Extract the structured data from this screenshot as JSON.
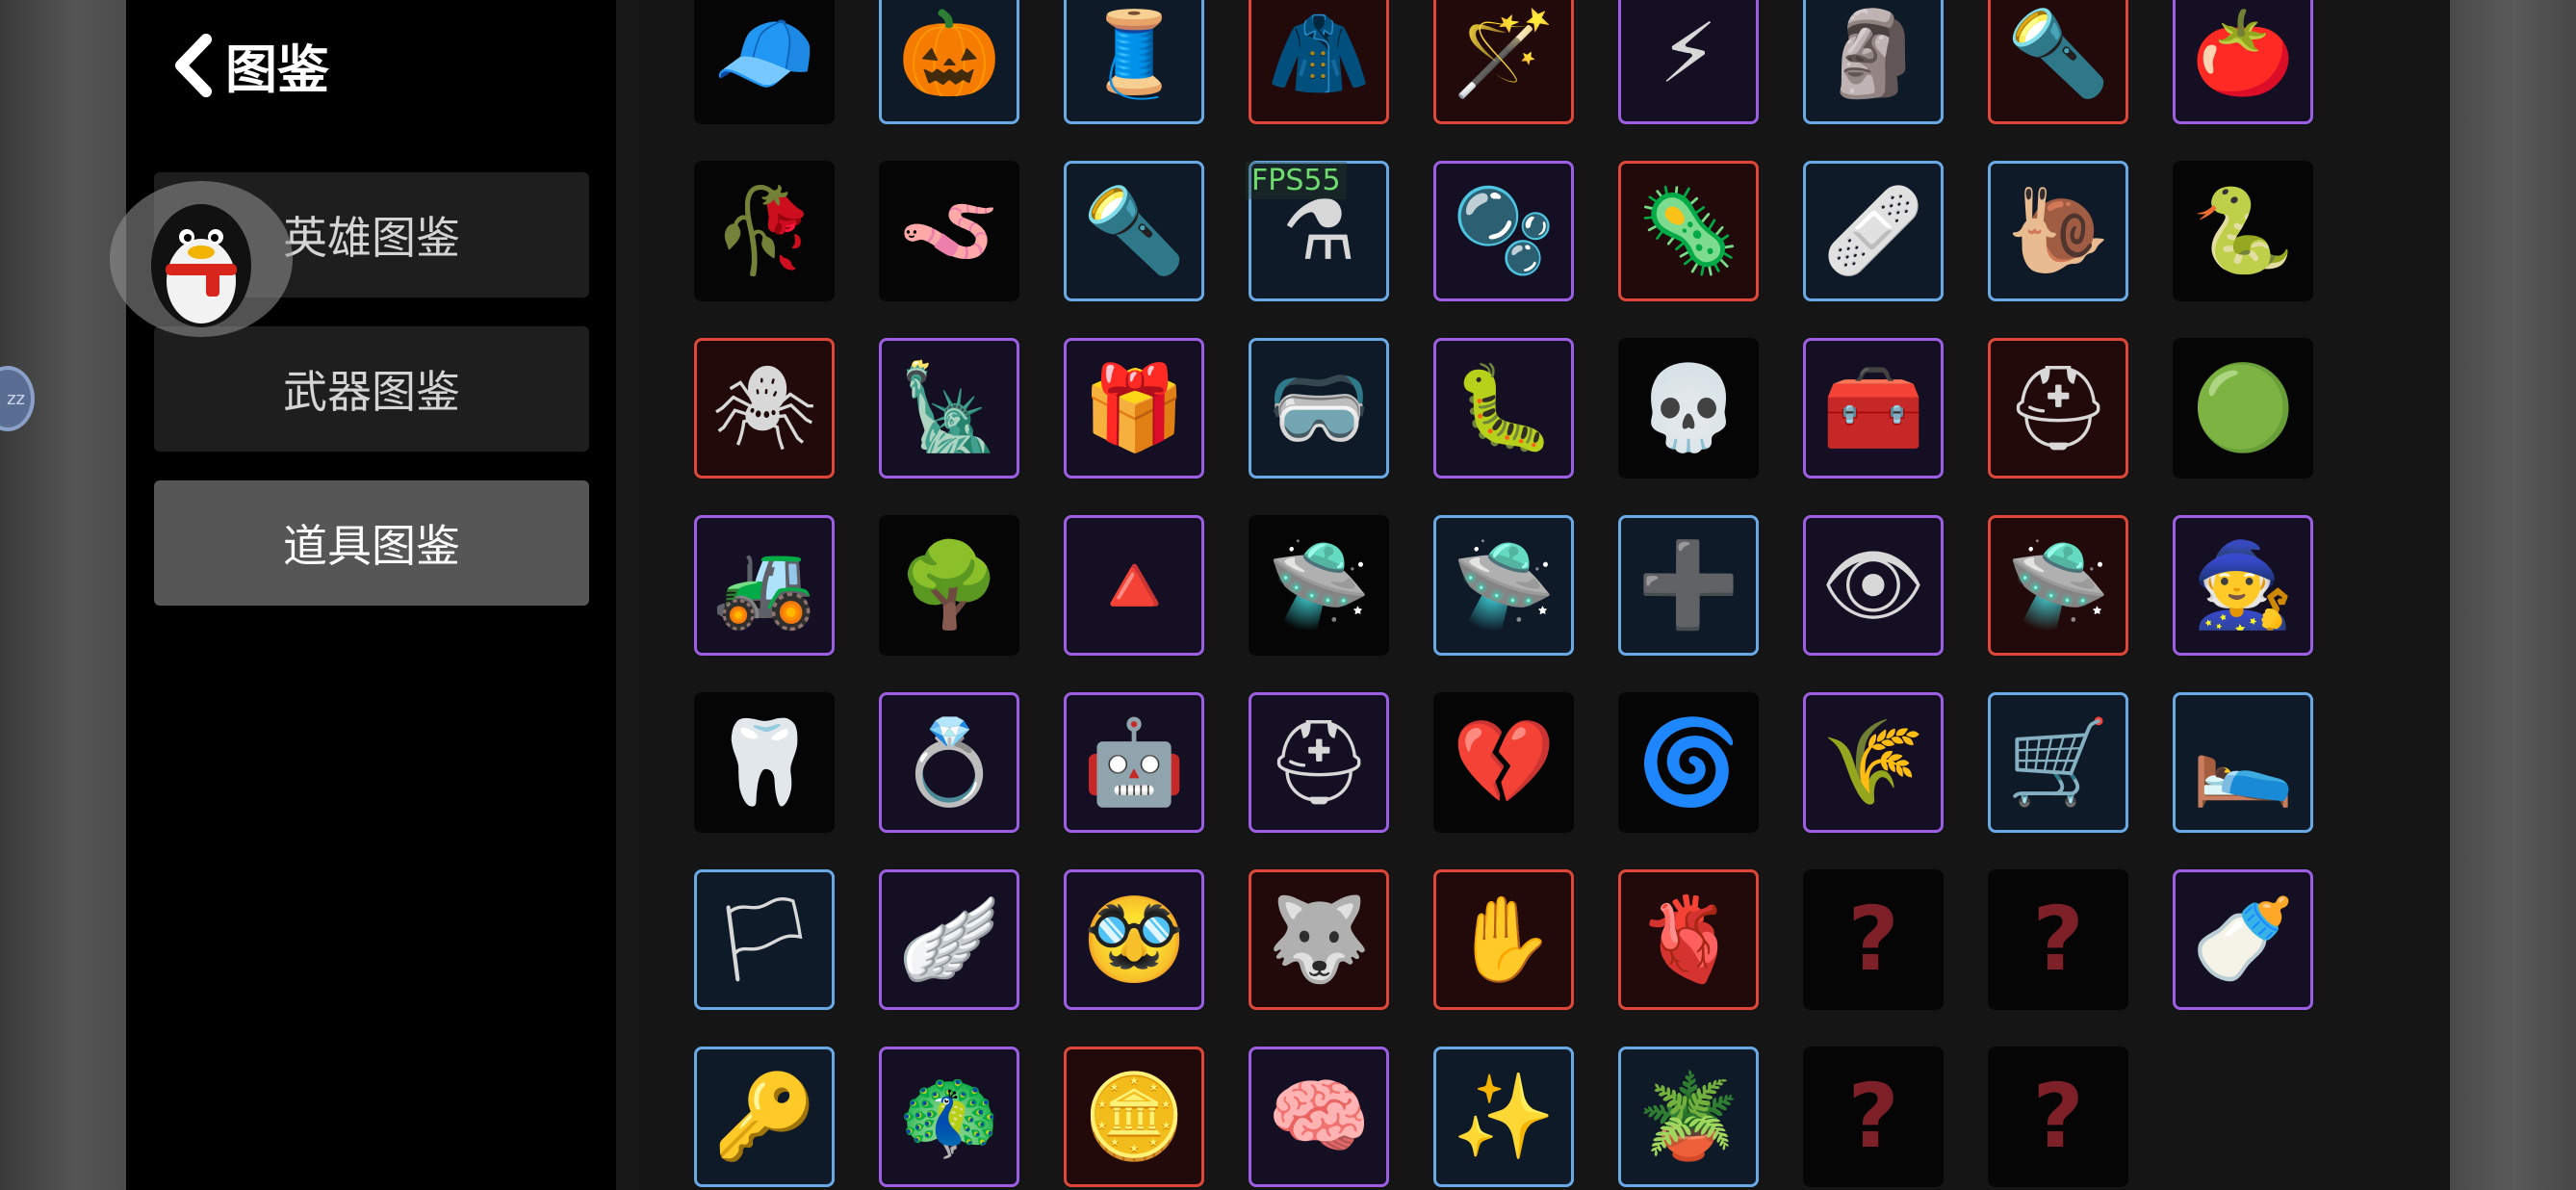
{
  "header": {
    "back_title": "图鉴"
  },
  "menu": [
    {
      "label": "英雄图鉴",
      "active": false
    },
    {
      "label": "武器图鉴",
      "active": false
    },
    {
      "label": "道具图鉴",
      "active": true
    }
  ],
  "overlay": {
    "fps": "FPS55",
    "float_dot_label": "zz"
  },
  "colors": {
    "blue": "#6aa8e6",
    "purple": "#9c5fe3",
    "red": "#e0473a"
  },
  "items": [
    {
      "icon": "propeller-cap-icon",
      "glyph": "🧢",
      "rarity": "none"
    },
    {
      "icon": "pumpkin-icon",
      "glyph": "🎃",
      "rarity": "blue"
    },
    {
      "icon": "sewing-machine-icon",
      "glyph": "🧵",
      "rarity": "blue"
    },
    {
      "icon": "red-hoodie-icon",
      "glyph": "🧥",
      "rarity": "red"
    },
    {
      "icon": "magic-wand-icon",
      "glyph": "🪄",
      "rarity": "red"
    },
    {
      "icon": "claw-marks-icon",
      "glyph": "⚡",
      "rarity": "purple"
    },
    {
      "icon": "stone-circle-icon",
      "glyph": "🗿",
      "rarity": "blue"
    },
    {
      "icon": "torch-icon",
      "glyph": "🔦",
      "rarity": "red"
    },
    {
      "icon": "sad-tomato-icon",
      "glyph": "🍅",
      "rarity": "purple"
    },
    {
      "icon": "thorn-branch-icon",
      "glyph": "🥀",
      "rarity": "none"
    },
    {
      "icon": "worm-icon",
      "glyph": "🪱",
      "rarity": "none"
    },
    {
      "icon": "flashlight-icon",
      "glyph": "🔦",
      "rarity": "blue"
    },
    {
      "icon": "potion-flask-icon",
      "glyph": "⚗",
      "rarity": "blue"
    },
    {
      "icon": "pink-blob-icon",
      "glyph": "🫧",
      "rarity": "purple"
    },
    {
      "icon": "virus-icon",
      "glyph": "🦠",
      "rarity": "red"
    },
    {
      "icon": "wrapped-bandage-icon",
      "glyph": "🩹",
      "rarity": "blue"
    },
    {
      "icon": "snail-icon",
      "glyph": "🐌",
      "rarity": "blue"
    },
    {
      "icon": "snake-icon",
      "glyph": "🐍",
      "rarity": "none"
    },
    {
      "icon": "spider-icon",
      "glyph": "🕷",
      "rarity": "red"
    },
    {
      "icon": "statue-icon",
      "glyph": "🗽",
      "rarity": "purple"
    },
    {
      "icon": "gift-box-icon",
      "glyph": "🎁",
      "rarity": "purple"
    },
    {
      "icon": "goggles-icon",
      "glyph": "🥽",
      "rarity": "blue"
    },
    {
      "icon": "tardigrade-icon",
      "glyph": "🐛",
      "rarity": "purple"
    },
    {
      "icon": "skull-face-icon",
      "glyph": "💀",
      "rarity": "none"
    },
    {
      "icon": "toolbox-icon",
      "glyph": "🧰",
      "rarity": "purple"
    },
    {
      "icon": "dark-helmet-icon",
      "glyph": "⛑",
      "rarity": "red"
    },
    {
      "icon": "green-slime-icon",
      "glyph": "🟢",
      "rarity": "none"
    },
    {
      "icon": "tractor-icon",
      "glyph": "🚜",
      "rarity": "purple"
    },
    {
      "icon": "tree-icon",
      "glyph": "🌳",
      "rarity": "none"
    },
    {
      "icon": "triangle-prism-icon",
      "glyph": "🔺",
      "rarity": "purple"
    },
    {
      "icon": "yellow-drone-icon",
      "glyph": "🛸",
      "rarity": "none"
    },
    {
      "icon": "dark-drone-icon",
      "glyph": "🛸",
      "rarity": "blue"
    },
    {
      "icon": "medic-drone-icon",
      "glyph": "➕",
      "rarity": "blue"
    },
    {
      "icon": "eye-drone-icon",
      "glyph": "👁",
      "rarity": "purple"
    },
    {
      "icon": "green-drone-icon",
      "glyph": "🛸",
      "rarity": "red"
    },
    {
      "icon": "hooded-figure-icon",
      "glyph": "🧙",
      "rarity": "purple"
    },
    {
      "icon": "tooth-icon",
      "glyph": "🦷",
      "rarity": "none"
    },
    {
      "icon": "ring-icon",
      "glyph": "💍",
      "rarity": "purple"
    },
    {
      "icon": "robot-pod-icon",
      "glyph": "🤖",
      "rarity": "purple"
    },
    {
      "icon": "knight-helmet-icon",
      "glyph": "⛑",
      "rarity": "purple"
    },
    {
      "icon": "pierced-heart-icon",
      "glyph": "💔",
      "rarity": "none"
    },
    {
      "icon": "spiral-spirit-icon",
      "glyph": "🌀",
      "rarity": "none"
    },
    {
      "icon": "wheat-icon",
      "glyph": "🌾",
      "rarity": "purple"
    },
    {
      "icon": "wheelbarrow-icon",
      "glyph": "🛒",
      "rarity": "blue"
    },
    {
      "icon": "sleeping-bag-icon",
      "glyph": "🛌",
      "rarity": "blue"
    },
    {
      "icon": "white-flag-icon",
      "glyph": "🏳",
      "rarity": "blue"
    },
    {
      "icon": "angel-wings-icon",
      "glyph": "🪽",
      "rarity": "purple"
    },
    {
      "icon": "beard-mask-icon",
      "glyph": "🥸",
      "rarity": "purple"
    },
    {
      "icon": "wolf-head-icon",
      "glyph": "🐺",
      "rarity": "red"
    },
    {
      "icon": "bloody-hand-icon",
      "glyph": "✋",
      "rarity": "red"
    },
    {
      "icon": "stomach-icon",
      "glyph": "🫀",
      "rarity": "red"
    },
    {
      "icon": "unknown-item-icon",
      "glyph": "?",
      "rarity": "none"
    },
    {
      "icon": "unknown-item-icon",
      "glyph": "?",
      "rarity": "none"
    },
    {
      "icon": "bottle-icon",
      "glyph": "🍼",
      "rarity": "purple"
    },
    {
      "icon": "mushroom-key-icon",
      "glyph": "🔑",
      "rarity": "blue"
    },
    {
      "icon": "peacock-icon",
      "glyph": "🦚",
      "rarity": "purple"
    },
    {
      "icon": "gold-coin-icon",
      "glyph": "🪙",
      "rarity": "red"
    },
    {
      "icon": "pink-brain-icon",
      "glyph": "🧠",
      "rarity": "purple"
    },
    {
      "icon": "claw-slash-icon",
      "glyph": "✨",
      "rarity": "blue"
    },
    {
      "icon": "planter-box-icon",
      "glyph": "🪴",
      "rarity": "blue"
    },
    {
      "icon": "unknown-item-icon",
      "glyph": "?",
      "rarity": "none"
    },
    {
      "icon": "unknown-item-icon",
      "glyph": "?",
      "rarity": "none"
    }
  ]
}
